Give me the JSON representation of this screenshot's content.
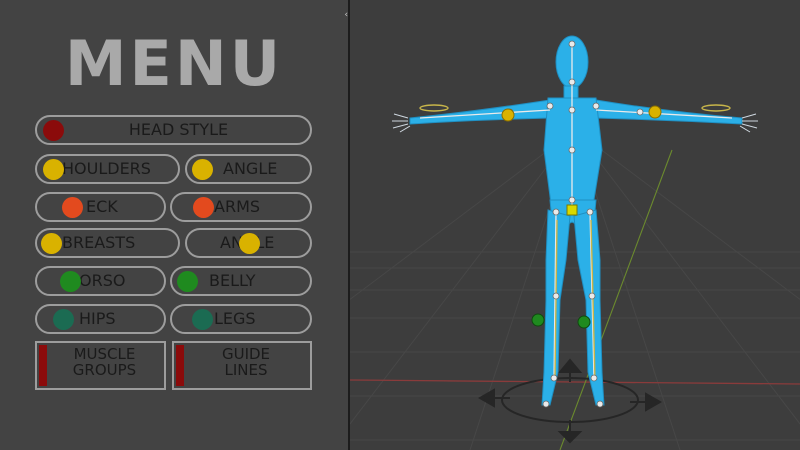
{
  "menu": {
    "title": "MENU",
    "buttons": {
      "head_style": {
        "label": "HEAD STYLE",
        "dot": "#8b0b0b"
      },
      "shoulders": {
        "label": "HOULDERS",
        "dot": "#d9b200"
      },
      "angle": {
        "label": "ANGLE",
        "dot": "#d9b200"
      },
      "neck": {
        "label": "ECK",
        "dot": "#e34a1e"
      },
      "arms": {
        "label": "ARMS",
        "dot": "#e34a1e"
      },
      "breasts": {
        "label": "BREASTS",
        "dot": "#d9b200"
      },
      "angle2": {
        "label": "ANGLE",
        "dot": "#d9b200"
      },
      "torso": {
        "label": "ORSO",
        "dot": "#1f8a1f"
      },
      "belly": {
        "label": "BELLY",
        "dot": "#1f8a1f"
      },
      "hips": {
        "label": "HIPS",
        "dot": "#1b6b52"
      },
      "legs": {
        "label": "LEGS",
        "dot": "#1b6b52"
      }
    },
    "muscle_groups": {
      "line1": "MUSCLE",
      "line2": "GROUPS"
    },
    "guide_lines": {
      "line1": "GUIDE",
      "line2": "LINES"
    }
  },
  "divider": {
    "handle": "‹›"
  },
  "viewport": {
    "model": "blue humanoid rig in T-pose",
    "colors": {
      "body": "#2bb0e8",
      "bone": "#e8e8e8",
      "grid": "#474747",
      "x_axis": "#8a3b3b",
      "y_axis": "#6b8a2e"
    }
  }
}
